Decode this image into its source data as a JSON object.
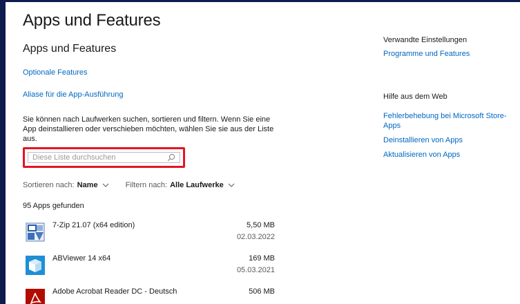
{
  "window": {
    "title": "Apps und Features"
  },
  "main": {
    "section_title": "Apps und Features",
    "link_optional": "Optionale Features",
    "link_alias": "Aliase für die App-Ausführung",
    "description": "Sie können nach Laufwerken suchen, sortieren und filtern. Wenn Sie eine App deinstallieren oder verschieben möchten, wählen Sie sie aus der Liste aus.",
    "search": {
      "placeholder": "Diese Liste durchsuchen",
      "value": "",
      "highlight_color": "#e81123"
    },
    "sort": {
      "label": "Sortieren nach:",
      "value": "Name"
    },
    "filter": {
      "label": "Filtern nach:",
      "value": "Alle Laufwerke"
    },
    "count": "95 Apps gefunden",
    "apps": [
      {
        "name": "7-Zip 21.07 (x64 edition)",
        "size": "5,50 MB",
        "date": "02.03.2022",
        "icon": "7zip-icon"
      },
      {
        "name": "ABViewer 14 x64",
        "size": "169 MB",
        "date": "05.03.2021",
        "icon": "abviewer-icon"
      },
      {
        "name": "Adobe Acrobat Reader DC - Deutsch",
        "size": "506 MB",
        "date": "",
        "icon": "acrobat-icon"
      }
    ]
  },
  "sidebar": {
    "related_heading": "Verwandte Einstellungen",
    "related_link": "Programme und Features",
    "help_heading": "Hilfe aus dem Web",
    "help_links": [
      "Fehlerbehebung bei Microsoft Store-Apps",
      "Deinstallieren von Apps",
      "Aktualisieren von Apps"
    ]
  },
  "colors": {
    "accent_link": "#0067c0",
    "frame": "#0d1b4d",
    "highlight": "#e81123"
  }
}
